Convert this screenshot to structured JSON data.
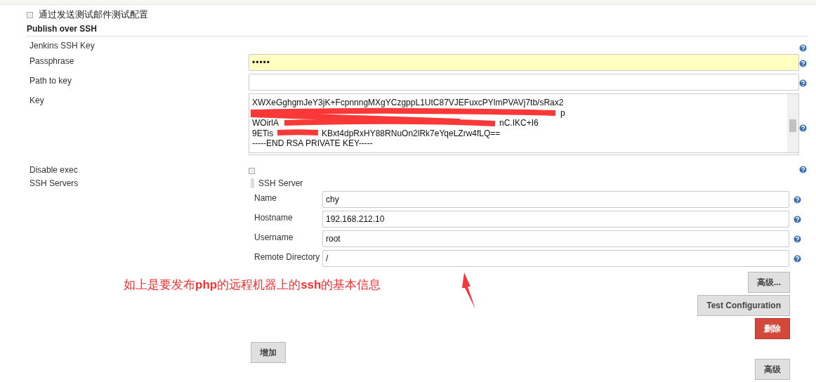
{
  "top_option": {
    "label": "通过发送测试邮件测试配置",
    "checked": false
  },
  "section_title": "Publish over SSH",
  "fields": [
    {
      "kind": "heading",
      "label": "Jenkins SSH Key"
    },
    {
      "kind": "password",
      "label": "Passphrase",
      "value": "•••••"
    },
    {
      "kind": "text",
      "label": "Path to key"
    },
    {
      "kind": "textarea",
      "label": "Key",
      "lines": [
        {
          "left": "XWXeGghgmJeY3jK+FcpnnngMXgYCzgppL1UtC87VJEFuxcPYlmPVAVj7tb/sRax2"
        },
        {
          "right": "p"
        },
        {
          "left": "WOirlA",
          "right": "nC.IKC+I6"
        },
        {
          "left": "9ETis",
          "right": "KBxt4dpRxHY88RNuOn2lRk7eYqeLZrw4fLQ=="
        },
        {
          "left": "-----END RSA PRIVATE KEY-----"
        }
      ]
    },
    {
      "kind": "checkbox",
      "label": "Disable exec",
      "checked": false
    }
  ],
  "ssh_servers": {
    "label": "SSH Servers",
    "server": {
      "title": "SSH Server",
      "fields": [
        {
          "label": "Name",
          "value": "chy"
        },
        {
          "label": "Hostname",
          "value": "192.168.212.10"
        },
        {
          "label": "Username",
          "value": "root"
        },
        {
          "label": "Remote Directory",
          "value": "/"
        }
      ],
      "buttons": [
        {
          "label": "高级...",
          "kind": "plain"
        },
        {
          "label": "Test Configuration",
          "kind": "plain"
        },
        {
          "label": "删除",
          "kind": "danger"
        }
      ]
    },
    "add_button": "增加"
  },
  "annotation": "如上是要发布**php**的远程机器上的**ssh**的基本信息",
  "bottom_button": "高级"
}
